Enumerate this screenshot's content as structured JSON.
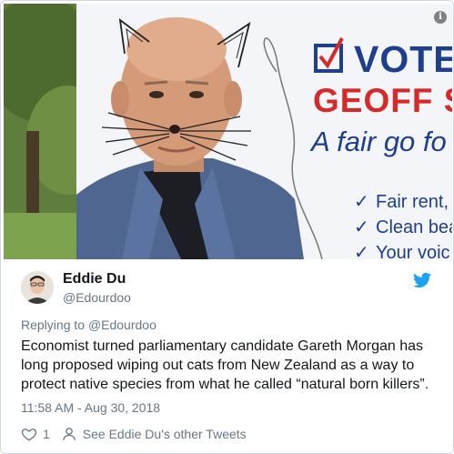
{
  "photo": {
    "sign_vote": "VOTE",
    "sign_geoff": "GEOFF S",
    "sign_tagline": "A fair go fo",
    "sign_items": [
      "Fair rent,",
      "Clean bea",
      "Your voic"
    ],
    "sign_check": "✓",
    "info_glyph": "i",
    "colors": {
      "navy": "#1e3f8e",
      "red": "#d62a2a"
    }
  },
  "author": {
    "name": "Eddie Du",
    "handle": "@Edourdoo"
  },
  "tweet": {
    "reply_prefix": "Replying to",
    "reply_handle": "@Edourdoo",
    "lines": [
      "Economist turned parliamentary candidate Gareth Morgan has",
      "long proposed wiping out cats from New Zealand as a way to",
      "protect native species from what he called “natural born killers”."
    ],
    "timestamp": "11:58 AM - Aug 30, 2018"
  },
  "footer": {
    "like_count": "1",
    "other_tweets_label": "See Eddie Du's other Tweets"
  },
  "icons": {
    "bird": "twitter-bird-icon",
    "heart": "heart-icon",
    "person": "person-icon",
    "info": "info-icon"
  },
  "colors": {
    "twitter_blue": "#1da1f2",
    "text": "#14171a",
    "muted": "#657786"
  }
}
